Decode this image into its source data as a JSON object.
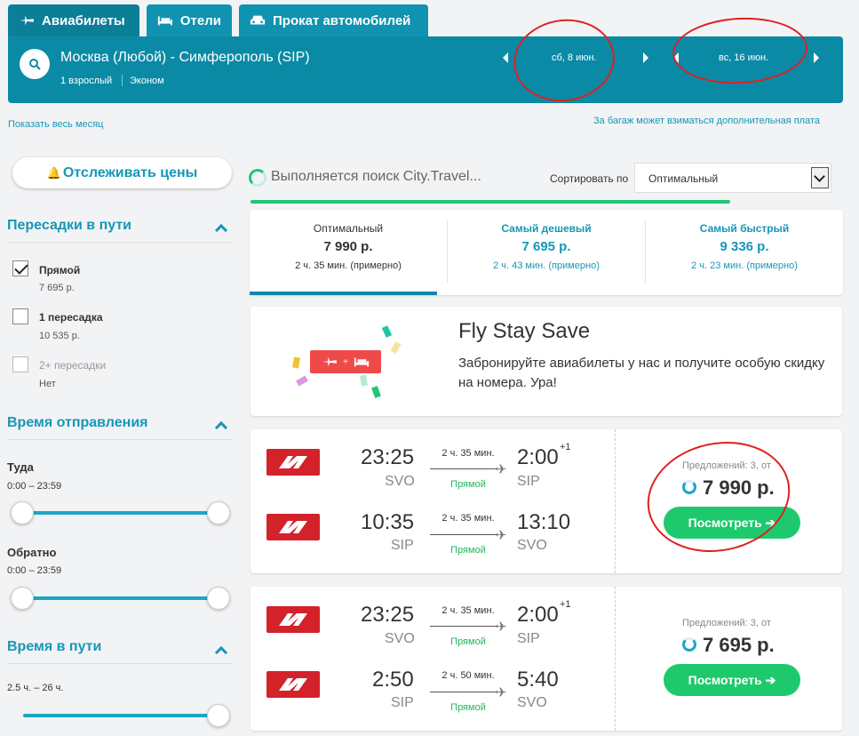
{
  "tabs": [
    {
      "label": "Авиабилеты",
      "active": true
    },
    {
      "label": "Отели",
      "active": false
    },
    {
      "label": "Прокат автомобилей",
      "active": false
    }
  ],
  "search": {
    "route": "Москва (Любой) - Симферополь (SIP)",
    "passengers": "1 взрослый",
    "class": "Эконом",
    "date_out": "сб, 8 июн.",
    "date_back": "вс, 16 июн."
  },
  "links": {
    "whole_month": "Показать весь месяц",
    "baggage_note": "За багаж может взиматься дополнительная плата"
  },
  "sidebar": {
    "track_label": "Отслеживать цены",
    "stops": {
      "title": "Пересадки в пути",
      "options": [
        {
          "label": "Прямой",
          "price": "7 695 р.",
          "checked": true
        },
        {
          "label": "1 пересадка",
          "price": "10 535 р.",
          "checked": false
        },
        {
          "label": "2+ пересадки",
          "price": "Нет",
          "checked": false
        }
      ]
    },
    "departure": {
      "title": "Время отправления",
      "out_label": "Туда",
      "out_range": "0:00 – 23:59",
      "back_label": "Обратно",
      "back_range": "0:00 – 23:59"
    },
    "duration": {
      "title": "Время в пути",
      "range": "2.5 ч. – 26 ч."
    }
  },
  "main": {
    "searching_text": "Выполняется поиск City.Travel...",
    "sort_label": "Сортировать по",
    "sort_value": "Оптимальный",
    "sort_tabs": [
      {
        "title": "Оптимальный",
        "price": "7 990 р.",
        "duration": "2 ч. 35 мин. (примерно)"
      },
      {
        "title": "Самый дешевый",
        "price": "7 695 р.",
        "duration": "2 ч. 43 мин. (примерно)"
      },
      {
        "title": "Самый быстрый",
        "price": "9 336 р.",
        "duration": "2 ч. 23 мин. (примерно)"
      }
    ],
    "promo": {
      "title": "Fly Stay Save",
      "text": "Забронируйте авиабилеты у нас и получите особую скидку на номера. Ура!",
      "badge_plus": "+"
    },
    "results": [
      {
        "legs": [
          {
            "dep_time": "23:25",
            "dep_code": "SVO",
            "duration": "2 ч. 35 мин.",
            "stops": "Прямой",
            "arr_time": "2:00",
            "arr_plus": "+1",
            "arr_code": "SIP"
          },
          {
            "dep_time": "10:35",
            "dep_code": "SIP",
            "duration": "2 ч. 35 мин.",
            "stops": "Прямой",
            "arr_time": "13:10",
            "arr_plus": "",
            "arr_code": "SVO"
          }
        ],
        "offers": "Предложений: 3, от",
        "price": "7 990 р.",
        "button": "Посмотреть ➔"
      },
      {
        "legs": [
          {
            "dep_time": "23:25",
            "dep_code": "SVO",
            "duration": "2 ч. 35 мин.",
            "stops": "Прямой",
            "arr_time": "2:00",
            "arr_plus": "+1",
            "arr_code": "SIP"
          },
          {
            "dep_time": "2:50",
            "dep_code": "SIP",
            "duration": "2 ч. 50 мин.",
            "stops": "Прямой",
            "arr_time": "5:40",
            "arr_plus": "",
            "arr_code": "SVO"
          }
        ],
        "offers": "Предложений: 3, от",
        "price": "7 695 р.",
        "button": "Посмотреть ➔"
      }
    ]
  },
  "colors": {
    "accent": "#0b8aa6",
    "link": "#1597b8",
    "green": "#1ec96d",
    "airline_red": "#d3222a",
    "annotation": "#e02020"
  },
  "icons": [
    "plane-icon",
    "bed-icon",
    "car-icon",
    "search-icon",
    "bell-icon",
    "chevron-up-icon",
    "airline-logo-icon"
  ]
}
